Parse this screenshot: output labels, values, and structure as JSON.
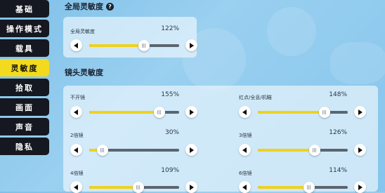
{
  "sidebar": {
    "items": [
      {
        "label": "基础",
        "active": false
      },
      {
        "label": "操作模式",
        "active": false
      },
      {
        "label": "载具",
        "active": false
      },
      {
        "label": "灵敏度",
        "active": true
      },
      {
        "label": "拾取",
        "active": false
      },
      {
        "label": "画面",
        "active": false
      },
      {
        "label": "声音",
        "active": false
      },
      {
        "label": "隐私",
        "active": false
      }
    ]
  },
  "global": {
    "title": "全局灵敏度",
    "help_icon": "?",
    "slider": {
      "label": "全局灵敏度",
      "value": "122%",
      "fraction": 0.61
    }
  },
  "camera": {
    "title": "镜头灵敏度",
    "sliders": [
      {
        "label": "不开镜",
        "value": "155%",
        "fraction": 0.78
      },
      {
        "label": "红点/全息/机瞄",
        "value": "148%",
        "fraction": 0.74
      },
      {
        "label": "2倍镜",
        "value": "30%",
        "fraction": 0.15
      },
      {
        "label": "3倍镜",
        "value": "126%",
        "fraction": 0.63
      },
      {
        "label": "4倍镜",
        "value": "109%",
        "fraction": 0.55
      },
      {
        "label": "6倍镜",
        "value": "114%",
        "fraction": 0.57
      }
    ]
  },
  "colors": {
    "accent": "#f2da1f",
    "sidebar_bg": "#151820",
    "track": "#5b6570"
  }
}
